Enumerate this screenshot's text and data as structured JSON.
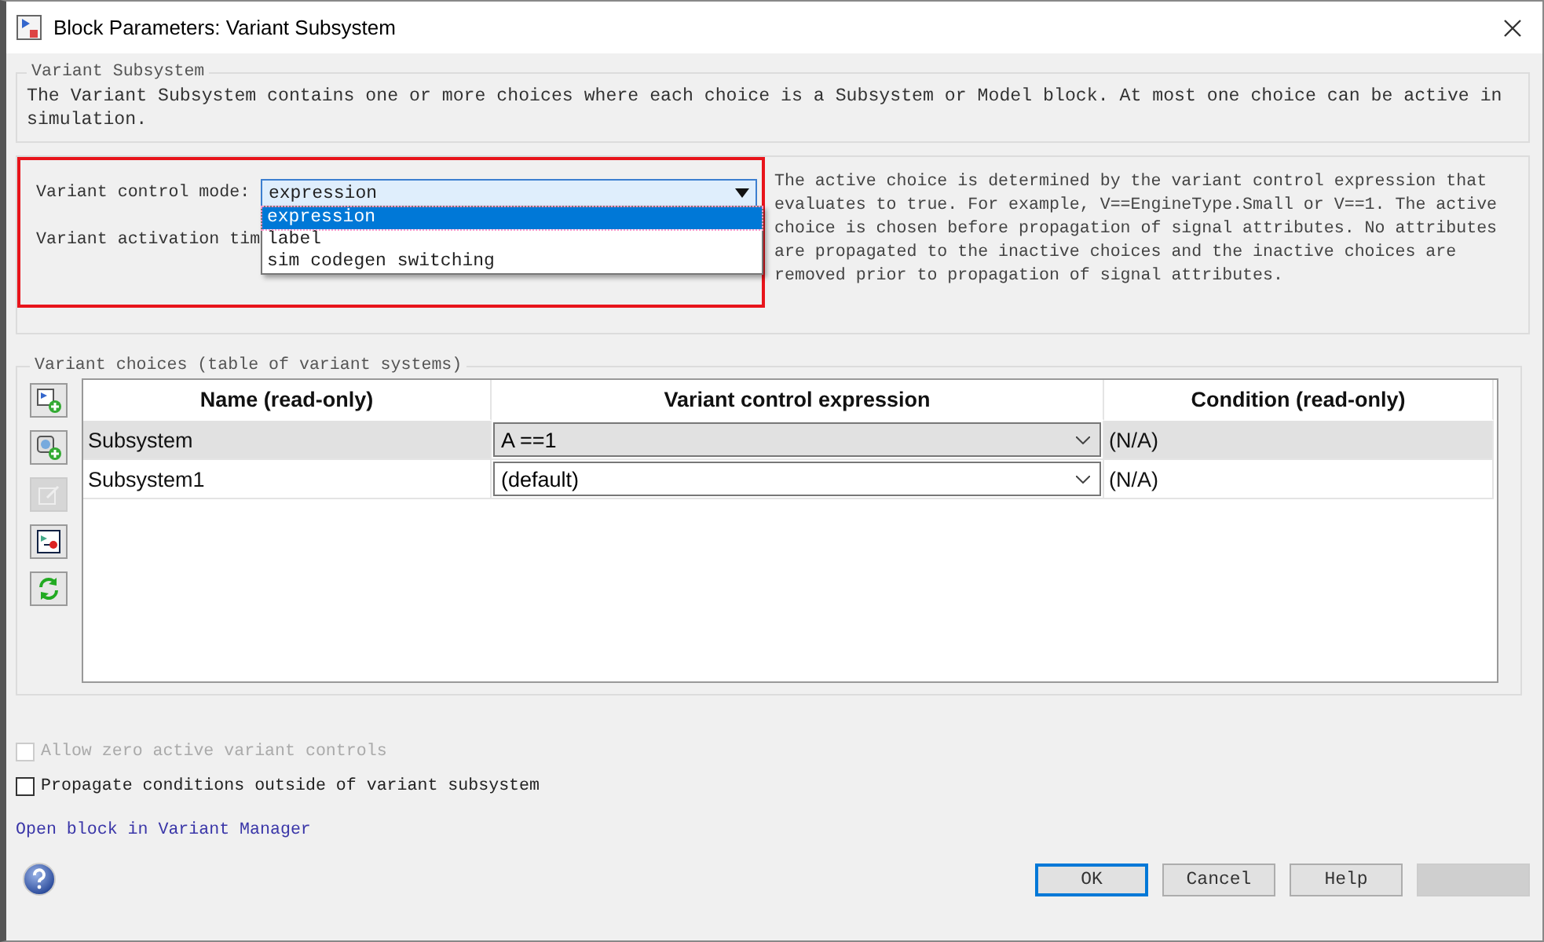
{
  "window": {
    "title": "Block Parameters: Variant Subsystem"
  },
  "description_group": {
    "title": "Variant Subsystem",
    "text": "The Variant Subsystem contains one or more choices where each choice is a Subsystem or Model block. At most one choice can be active in simulation."
  },
  "parameters": {
    "highlighted": true,
    "fields": [
      {
        "label": "Variant control mode:",
        "value": "expression",
        "expanded": true,
        "options": [
          {
            "label": "expression",
            "selected": true
          },
          {
            "label": "label",
            "selected": false
          },
          {
            "label": "sim codegen switching",
            "selected": false
          }
        ]
      },
      {
        "label": "Variant activation tim"
      }
    ],
    "help_text": "The active choice is determined by the variant control expression that evaluates to true. For example, V==EngineType.Small or V==1. The active choice is chosen before propagation of signal attributes. No attributes are propagated to the inactive choices and the inactive choices are removed prior to propagation of signal attributes."
  },
  "choices": {
    "title": "Variant choices (table of variant systems)",
    "toolbar": [
      {
        "kind": "add",
        "disabled": false
      },
      {
        "kind": "addmodel",
        "disabled": false
      },
      {
        "kind": "edit",
        "disabled": true
      },
      {
        "kind": "port",
        "disabled": false
      },
      {
        "kind": "refresh",
        "disabled": false
      }
    ],
    "columns": [
      "Name (read-only)",
      "Variant control expression",
      "Condition (read-only)"
    ],
    "rows": [
      {
        "name": "Subsystem",
        "expression": "A ==1",
        "condition": "(N/A)",
        "selected": true
      },
      {
        "name": "Subsystem1",
        "expression": "(default)",
        "condition": "(N/A)",
        "selected": false
      }
    ]
  },
  "checkboxes": [
    {
      "label": "Allow zero active variant controls",
      "checked": false,
      "disabled": true
    },
    {
      "label": "Propagate conditions outside of variant subsystem",
      "checked": false,
      "disabled": false
    }
  ],
  "link": "Open block in Variant Manager",
  "buttons": [
    {
      "label": "OK",
      "default": true,
      "disabled": false
    },
    {
      "label": "Cancel",
      "default": false,
      "disabled": false
    },
    {
      "label": "Help",
      "default": false,
      "disabled": false
    },
    {
      "default": false,
      "disabled": true
    }
  ]
}
